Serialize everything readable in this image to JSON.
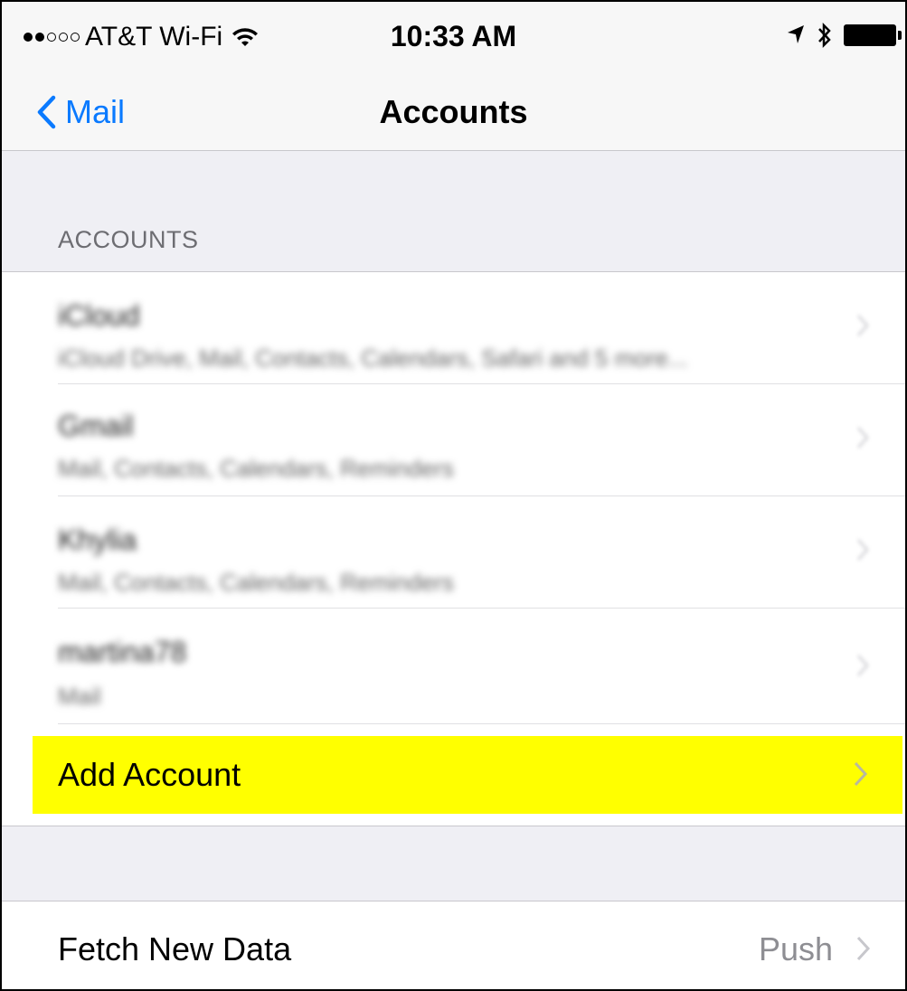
{
  "status_bar": {
    "carrier": "AT&T Wi-Fi",
    "time": "10:33 AM"
  },
  "nav": {
    "back_label": "Mail",
    "title": "Accounts"
  },
  "accounts_section": {
    "header": "ACCOUNTS",
    "items": [
      {
        "name": "iCloud",
        "services": "iCloud Drive, Mail, Contacts, Calendars, Safari and 5 more..."
      },
      {
        "name": "Gmail",
        "services": "Mail, Contacts, Calendars, Reminders"
      },
      {
        "name": "Khylia",
        "services": "Mail, Contacts, Calendars, Reminders"
      },
      {
        "name": "martina78",
        "services": "Mail"
      }
    ],
    "add_account_label": "Add Account"
  },
  "fetch": {
    "label": "Fetch New Data",
    "value": "Push"
  },
  "colors": {
    "accent": "#0a7aff",
    "highlight": "#ffff00",
    "background": "#efeff4"
  }
}
